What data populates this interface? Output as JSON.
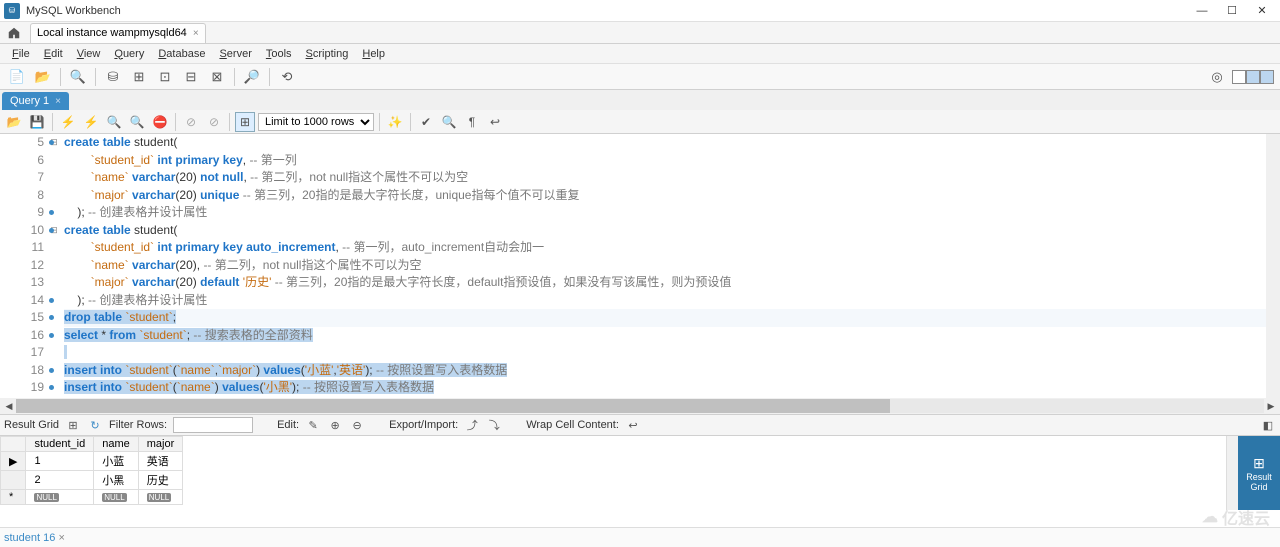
{
  "window": {
    "title": "MySQL Workbench"
  },
  "connection_tab": "Local instance wampmysqld64",
  "menu": [
    "File",
    "Edit",
    "View",
    "Query",
    "Database",
    "Server",
    "Tools",
    "Scripting",
    "Help"
  ],
  "query_tab": "Query 1",
  "limit_rows": "Limit to 1000 rows",
  "code": {
    "lines": [
      {
        "n": 5,
        "dot": true,
        "fold": "⊟",
        "segs": [
          [
            "kw",
            "create table"
          ],
          [
            "id",
            " student("
          ]
        ]
      },
      {
        "n": 6,
        "segs": [
          [
            "id",
            "        "
          ],
          [
            "str",
            "`student_id`"
          ],
          [
            "id",
            " "
          ],
          [
            "kw",
            "int primary key"
          ],
          [
            "id",
            ", "
          ],
          [
            "com",
            "-- 第一列"
          ]
        ]
      },
      {
        "n": 7,
        "segs": [
          [
            "id",
            "        "
          ],
          [
            "str",
            "`name`"
          ],
          [
            "id",
            " "
          ],
          [
            "kw",
            "varchar"
          ],
          [
            "id",
            "("
          ],
          [
            "id",
            "20"
          ],
          [
            "id",
            ") "
          ],
          [
            "kw",
            "not null"
          ],
          [
            "id",
            ", "
          ],
          [
            "com",
            "-- 第二列，not null指这个属性不可以为空"
          ]
        ]
      },
      {
        "n": 8,
        "segs": [
          [
            "id",
            "        "
          ],
          [
            "str",
            "`major`"
          ],
          [
            "id",
            " "
          ],
          [
            "kw",
            "varchar"
          ],
          [
            "id",
            "("
          ],
          [
            "id",
            "20"
          ],
          [
            "id",
            ") "
          ],
          [
            "kw",
            "unique"
          ],
          [
            "id",
            " "
          ],
          [
            "com",
            "-- 第三列，20指的是最大字符长度，unique指每个值不可以重复"
          ]
        ]
      },
      {
        "n": 9,
        "dot": true,
        "segs": [
          [
            "id",
            "    ); "
          ],
          [
            "com",
            "-- 创建表格并设计属性"
          ]
        ]
      },
      {
        "n": 10,
        "dot": true,
        "fold": "⊟",
        "segs": [
          [
            "kw",
            "create table"
          ],
          [
            "id",
            " student("
          ]
        ]
      },
      {
        "n": 11,
        "segs": [
          [
            "id",
            "        "
          ],
          [
            "str",
            "`student_id`"
          ],
          [
            "id",
            " "
          ],
          [
            "kw",
            "int primary key auto_increment"
          ],
          [
            "id",
            ", "
          ],
          [
            "com",
            "-- 第一列，auto_increment自动会加一"
          ]
        ]
      },
      {
        "n": 12,
        "segs": [
          [
            "id",
            "        "
          ],
          [
            "str",
            "`name`"
          ],
          [
            "id",
            " "
          ],
          [
            "kw",
            "varchar"
          ],
          [
            "id",
            "("
          ],
          [
            "id",
            "20"
          ],
          [
            "id",
            "), "
          ],
          [
            "com",
            "-- 第二列，not null指这个属性不可以为空"
          ]
        ]
      },
      {
        "n": 13,
        "segs": [
          [
            "id",
            "        "
          ],
          [
            "str",
            "`major`"
          ],
          [
            "id",
            " "
          ],
          [
            "kw",
            "varchar"
          ],
          [
            "id",
            "("
          ],
          [
            "id",
            "20"
          ],
          [
            "id",
            ") "
          ],
          [
            "kw",
            "default"
          ],
          [
            "id",
            " "
          ],
          [
            "str",
            "'历史'"
          ],
          [
            "id",
            " "
          ],
          [
            "com",
            "-- 第三列，20指的是最大字符长度，default指预设值，如果没有写该属性，则为预设值"
          ]
        ]
      },
      {
        "n": 14,
        "dot": true,
        "segs": [
          [
            "id",
            "    ); "
          ],
          [
            "com",
            "-- 创建表格并设计属性"
          ]
        ]
      },
      {
        "n": 15,
        "dot": true,
        "cursor": true,
        "sel": true,
        "segs": [
          [
            "kw",
            "drop table"
          ],
          [
            "id",
            " "
          ],
          [
            "str",
            "`student`"
          ],
          [
            "id",
            ";"
          ]
        ]
      },
      {
        "n": 16,
        "dot": true,
        "sel": true,
        "segs": [
          [
            "kw",
            "select"
          ],
          [
            "id",
            " * "
          ],
          [
            "kw",
            "from"
          ],
          [
            "id",
            " "
          ],
          [
            "str",
            "`student`"
          ],
          [
            "id",
            "; "
          ],
          [
            "com",
            "-- 搜索表格的全部资料"
          ]
        ]
      },
      {
        "n": 17,
        "sel": true,
        "segs": [
          [
            "id",
            " "
          ]
        ]
      },
      {
        "n": 18,
        "dot": true,
        "sel": true,
        "segs": [
          [
            "kw",
            "insert into"
          ],
          [
            "id",
            " "
          ],
          [
            "str",
            "`student`"
          ],
          [
            "id",
            "("
          ],
          [
            "str",
            "`name`"
          ],
          [
            "id",
            ","
          ],
          [
            "str",
            "`major`"
          ],
          [
            "id",
            ") "
          ],
          [
            "kw",
            "values"
          ],
          [
            "id",
            "("
          ],
          [
            "str",
            "'小蓝'"
          ],
          [
            "id",
            ","
          ],
          [
            "str",
            "'英语'"
          ],
          [
            "id",
            "); "
          ],
          [
            "com",
            "-- 按照设置写入表格数据"
          ]
        ]
      },
      {
        "n": 19,
        "dot": true,
        "sel": true,
        "segs": [
          [
            "kw",
            "insert into"
          ],
          [
            "id",
            " "
          ],
          [
            "str",
            "`student`"
          ],
          [
            "id",
            "("
          ],
          [
            "str",
            "`name`"
          ],
          [
            "id",
            ") "
          ],
          [
            "kw",
            "values"
          ],
          [
            "id",
            "("
          ],
          [
            "str",
            "'小黑'"
          ],
          [
            "id",
            "); "
          ],
          [
            "com",
            "-- 按照设置写入表格数据"
          ]
        ]
      }
    ]
  },
  "result_toolbar": {
    "result_grid": "Result Grid",
    "filter_rows": "Filter Rows:",
    "edit": "Edit:",
    "export_import": "Export/Import:",
    "wrap": "Wrap Cell Content:"
  },
  "grid": {
    "headers": [
      "student_id",
      "name",
      "major"
    ],
    "rows": [
      [
        "1",
        "小蓝",
        "英语"
      ],
      [
        "2",
        "小黑",
        "历史"
      ],
      [
        "NULL",
        "NULL",
        "NULL"
      ]
    ]
  },
  "side_panel": "Result\nGrid",
  "status_tab": "student 16",
  "watermark": "亿速云"
}
